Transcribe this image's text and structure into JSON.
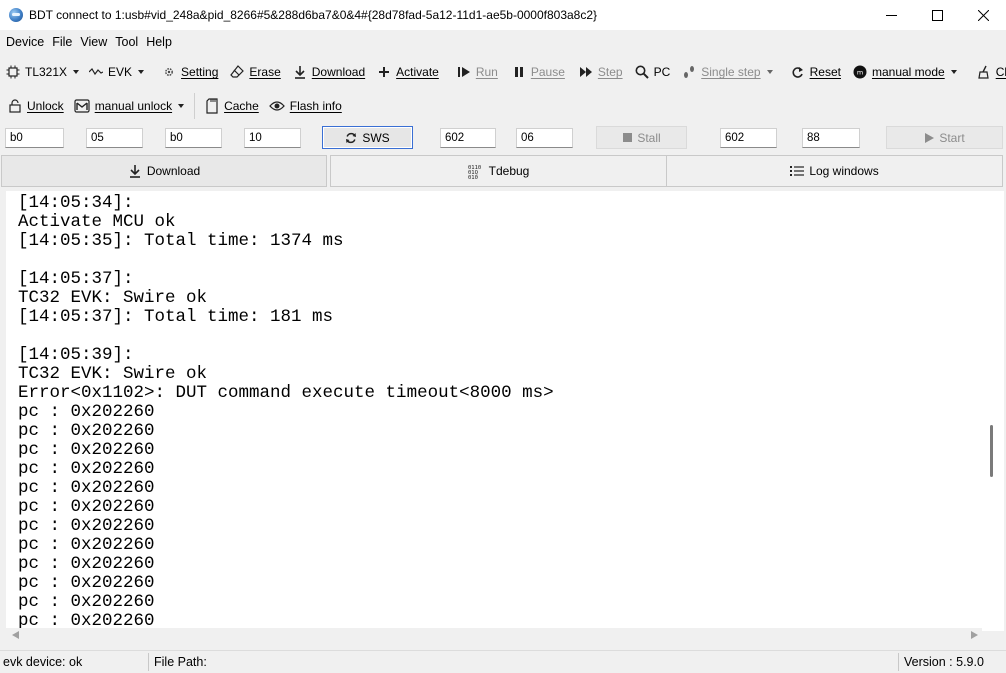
{
  "window": {
    "title": "BDT connect to 1:usb#vid_248a&pid_8266#5&288d6ba7&0&4#{28d78fad-5a12-11d1-ae5b-0000f803a8c2}"
  },
  "menu": [
    "Device",
    "File",
    "View",
    "Tool",
    "Help"
  ],
  "toolbar1": {
    "chip": "TL321X",
    "board": "EVK",
    "setting": "Setting",
    "erase": "Erase",
    "download": "Download",
    "activate": "Activate",
    "run": "Run",
    "pause": "Pause",
    "step": "Step",
    "pc": "PC",
    "single_step": "Single step",
    "reset": "Reset",
    "mode": "manual mode",
    "clear": "Clear"
  },
  "toolbar2": {
    "unlock": "Unlock",
    "manual_unlock": "manual unlock",
    "cache": "Cache",
    "flash_info": "Flash info"
  },
  "inputs": {
    "f1": "b0",
    "f2": "05",
    "f3": "b0",
    "f4": "10",
    "sws_label": "SWS",
    "f5": "602",
    "f6": "06",
    "stall_label": "Stall",
    "f7": "602",
    "f8": "88",
    "start_label": "Start"
  },
  "tabs": {
    "download": "Download",
    "tdebug": "Tdebug",
    "log": "Log windows"
  },
  "log_lines": [
    "[14:05:34]:",
    "Activate MCU ok",
    "[14:05:35]: Total time: 1374 ms",
    "",
    "[14:05:37]:",
    "TC32 EVK: Swire ok",
    "[14:05:37]: Total time: 181 ms",
    "",
    "[14:05:39]:",
    "TC32 EVK: Swire ok",
    "Error<0x1102>: DUT command execute timeout<8000 ms>",
    "pc : 0x202260",
    "pc : 0x202260",
    "pc : 0x202260",
    "pc : 0x202260",
    "pc : 0x202260",
    "pc : 0x202260",
    "pc : 0x202260",
    "pc : 0x202260",
    "pc : 0x202260",
    "pc : 0x202260",
    "pc : 0x202260",
    "pc : 0x202260"
  ],
  "status": {
    "device": "evk device: ok",
    "file_path": "File Path:",
    "version": "Version : 5.9.0"
  }
}
